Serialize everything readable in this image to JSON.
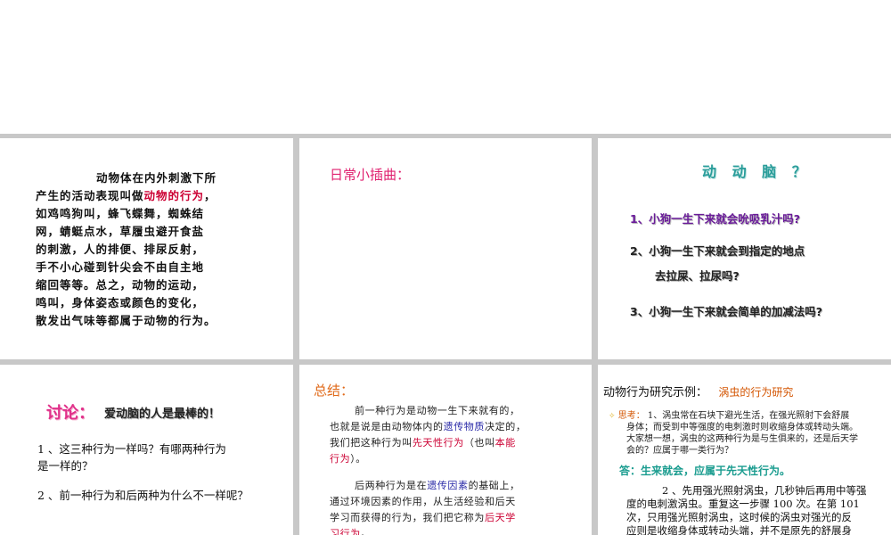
{
  "slide1": {
    "lines": [
      {
        "pre": "动物体在内外刺激下所",
        "hl": "",
        "post": ""
      },
      {
        "pre": "产生的活动表现叫做",
        "hl": "动物的行为",
        "post": "，"
      },
      {
        "pre": "如鸡鸣狗叫，蜂飞蝶舞，蜘蛛结",
        "hl": "",
        "post": ""
      },
      {
        "pre": "网，蜻蜓点水，草履虫避开食盐",
        "hl": "",
        "post": ""
      },
      {
        "pre": "的刺激，人的排便、排尿反射，",
        "hl": "",
        "post": ""
      },
      {
        "pre": "手不小心碰到针尖会不由自主地",
        "hl": "",
        "post": ""
      },
      {
        "pre": "缩回等等。总之，动物的运动，",
        "hl": "",
        "post": ""
      },
      {
        "pre": "鸣叫，身体姿态或颜色的变化，",
        "hl": "",
        "post": ""
      },
      {
        "pre": "散发出气味等都属于动物的行为。",
        "hl": "",
        "post": ""
      }
    ]
  },
  "slide2": {
    "title": "日常小插曲："
  },
  "slide3": {
    "title": "动 动 脑 ？",
    "q1": "1、小狗一生下来就会吮吸乳汁吗?",
    "q2a": "2、小狗一生下来就会到指定的地点",
    "q2b": "去拉屎、拉尿吗?",
    "q3": "3、小狗一生下来就会简单的加减法吗?"
  },
  "slide4": {
    "title": "讨论：",
    "subtitle": "爱动脑的人是最棒的！",
    "q1a": "1 、这三种行为一样吗？有哪两种行为",
    "q1b": "是一样的？",
    "q2": "2 、前一种行为和后两种为什么不一样呢？"
  },
  "slide5": {
    "title": "总结：",
    "p1_l1": "前一种行为是动物一生下来就有的，",
    "p1_l2_pre": "也就是说是由动物体内的",
    "p1_l2_hl": "遗传物质",
    "p1_l2_post": "决定的，",
    "p1_l3_pre": "我们把这种行为叫",
    "p1_l3_hl": "先天性行为",
    "p1_l3_mid": "（也叫",
    "p1_l3_hl2": "本能",
    "p1_l4_hl": "行为",
    "p1_l4_post": "）。",
    "p2_l1_pre": "后两种行为是在",
    "p2_l1_hl": "遗传因素",
    "p2_l1_post": "的基础上，",
    "p2_l2": "通过环境因素的作用，从生活经验和后天",
    "p2_l3_pre": "学习而获得的行为，我们把它称为",
    "p2_l3_hl": "后天学",
    "p2_l4_hl": "习行为",
    "p2_l4_post": "。"
  },
  "slide6": {
    "head": "动物行为研究示例：",
    "head_hl": "涡虫的行为研究",
    "think_label": "思考：",
    "t1": "1、涡虫常在石块下避光生活，在强光照射下会舒展",
    "t2": "身体；而受到中等强度的电刺激时则收缩身体或转动头端。",
    "t3": "大家想一想，涡虫的这两种行为是与生俱来的，还是后天学",
    "t4": "会的？应属于哪一类行为？",
    "answer": "答：生来就会，应属于先天性行为。",
    "m1": "2 、先用强光照射涡虫，几秒钟后再用中等强",
    "m2": "度的电刺激涡虫。重复这一步骤 100 次。在第 101",
    "m3": "次，只用强光照射涡虫，这时候的涡虫对强光的反",
    "m4": "应则是收缩身体或转动头端，并不是原先的舒展身"
  }
}
